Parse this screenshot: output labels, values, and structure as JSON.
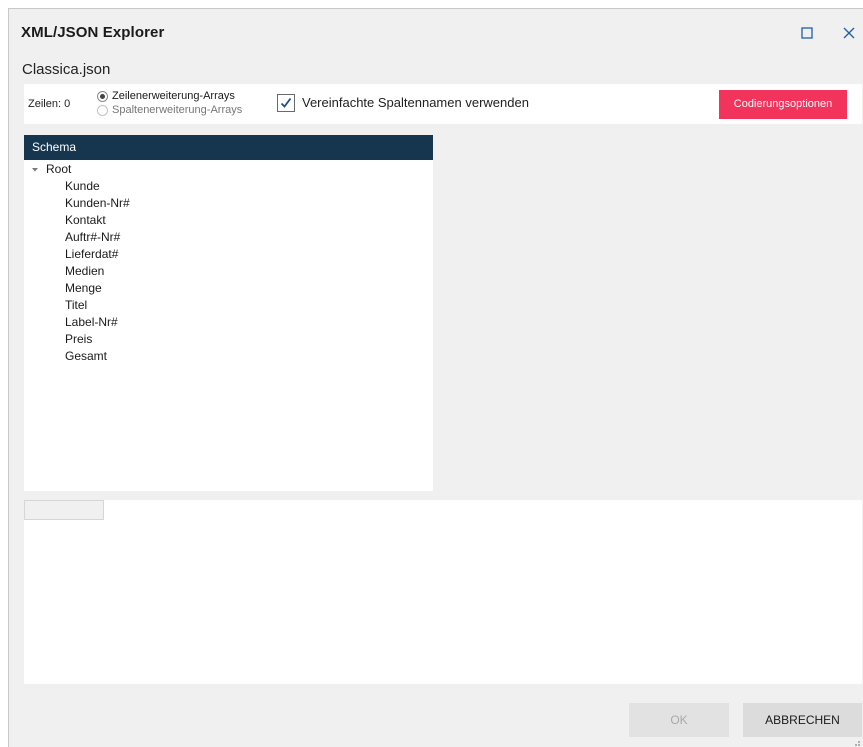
{
  "window": {
    "title": "XML/JSON Explorer",
    "maximize_icon": "maximize-icon",
    "close_icon": "close-icon"
  },
  "file": {
    "name": "Classica.json"
  },
  "options": {
    "rows_label": "Zeilen: 0",
    "radio_options": [
      {
        "label": "Zeilenerweiterung-Arrays",
        "selected": true
      },
      {
        "label": "Spaltenerweiterung-Arrays",
        "selected": false
      }
    ],
    "simplified_names_label": "Vereinfachte Spaltennamen verwenden",
    "simplified_names_checked": true,
    "coding_button_label": "Codierungsoptionen",
    "accent_color": "#f2335c"
  },
  "schema": {
    "header": "Schema",
    "header_color": "#16354f",
    "root_label": "Root",
    "root_expanded": true,
    "items": [
      "Kunde",
      "Kunden-Nr#",
      "Kontakt",
      "Auftr#-Nr#",
      "Lieferdat#",
      "Medien",
      "Menge",
      "Titel",
      "Label-Nr#",
      "Preis",
      "Gesamt"
    ]
  },
  "footer": {
    "ok_label": "OK",
    "ok_enabled": false,
    "cancel_label": "ABBRECHEN"
  }
}
